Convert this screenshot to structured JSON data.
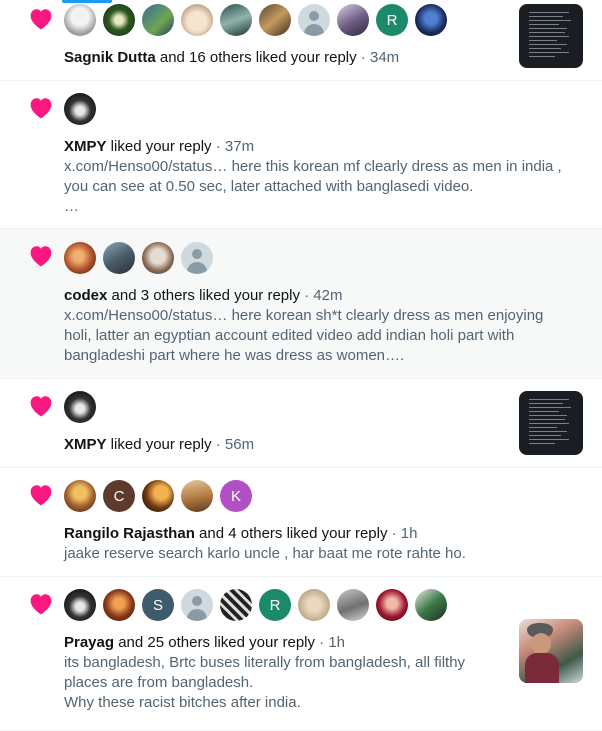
{
  "colors": {
    "heart": "#f91880",
    "accent": "#1d9bf0",
    "muted": "#536471",
    "text": "#0f1419"
  },
  "notifications": [
    {
      "icon": "heart-icon",
      "avatars": [
        "photo-gray",
        "photo-green",
        "photo-blue",
        "photo-dog",
        "photo-teal",
        "photo-brown",
        "default",
        "photo-teal2",
        "R",
        "photo-navy"
      ],
      "user": "Sagnik Dutta",
      "action": " and 16 others liked your reply",
      "time": " · 34m",
      "body": [],
      "has_thumbnail": true
    },
    {
      "icon": "heart-icon",
      "avatars": [
        "photo-dark"
      ],
      "user": "XMPY",
      "action": " liked your reply",
      "time": " · 37m",
      "body": [
        "x.com/Henso00/status… here this korean mf clearly dress as men in india ,",
        "you can see at 0.50 sec, later attached with banglasedi video.",
        "…"
      ],
      "has_thumbnail": false
    },
    {
      "icon": "heart-icon",
      "avatars": [
        "photo-orange",
        "photo-slate",
        "photo-face",
        "default"
      ],
      "user": "codex",
      "action": " and 3 others liked your reply",
      "time": " · 42m",
      "body": [
        "x.com/Henso00/status… here korean sh*t clearly dress as men enjoying",
        "holi, latter an egyptian account edited video add indian holi part with",
        "bangladeshi part where he was dress as women…."
      ],
      "has_thumbnail": false
    },
    {
      "icon": "heart-icon",
      "avatars": [
        "photo-dark"
      ],
      "user": "XMPY",
      "action": " liked your reply",
      "time": " · 56m",
      "body": [],
      "has_thumbnail": true
    },
    {
      "icon": "heart-icon",
      "avatars": [
        "photo-sunset",
        "C",
        "photo-silhouette",
        "photo-temple",
        "K"
      ],
      "user": "Rangilo Rajasthan",
      "action": " and 4 others liked your reply",
      "time": " · 1h",
      "body": [
        "jaake reserve search karlo uncle , har baat me rote rahte ho."
      ],
      "has_thumbnail": false
    },
    {
      "icon": "heart-icon",
      "avatars": [
        "photo-dark",
        "photo-fire",
        "S",
        "default",
        "photo-pattern",
        "R",
        "photo-beige",
        "photo-grey",
        "photo-red",
        "photo-green2"
      ],
      "user": "Prayag",
      "action": " and 25 others liked your reply",
      "time": " · 1h",
      "body": [
        "its bangladesh, Brtc  buses literally from bangladesh, all filthy",
        "places are from bangladesh.",
        "Why these racist bitches after india."
      ],
      "has_thumbnail": true
    }
  ]
}
